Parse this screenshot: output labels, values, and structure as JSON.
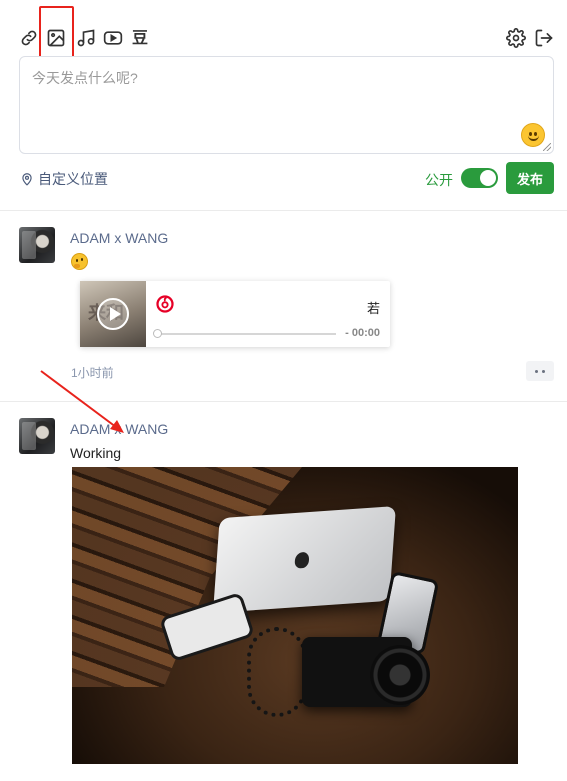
{
  "toolbar": {
    "icons": [
      "link-icon",
      "image-icon",
      "music-icon",
      "video-icon",
      "douban-icon",
      "gear-icon",
      "logout-icon"
    ],
    "douban_label": "豆",
    "highlight_color": "#e8231c"
  },
  "composer": {
    "placeholder": "今天发点什么呢?"
  },
  "footer": {
    "location_label": "自定义位置",
    "visibility_label": "公开",
    "visibility_on": true,
    "publish_label": "发布",
    "accent_color": "#2a9b3d"
  },
  "posts": [
    {
      "username": "ADAM x WANG",
      "emoji": "thinking-face",
      "music": {
        "cover_text": "来和",
        "right_label": "若",
        "time": "- 00:00",
        "progress": 0
      },
      "time_ago": "1小时前"
    },
    {
      "username": "ADAM x WANG",
      "text": "Working",
      "image": "desk-photo"
    }
  ]
}
